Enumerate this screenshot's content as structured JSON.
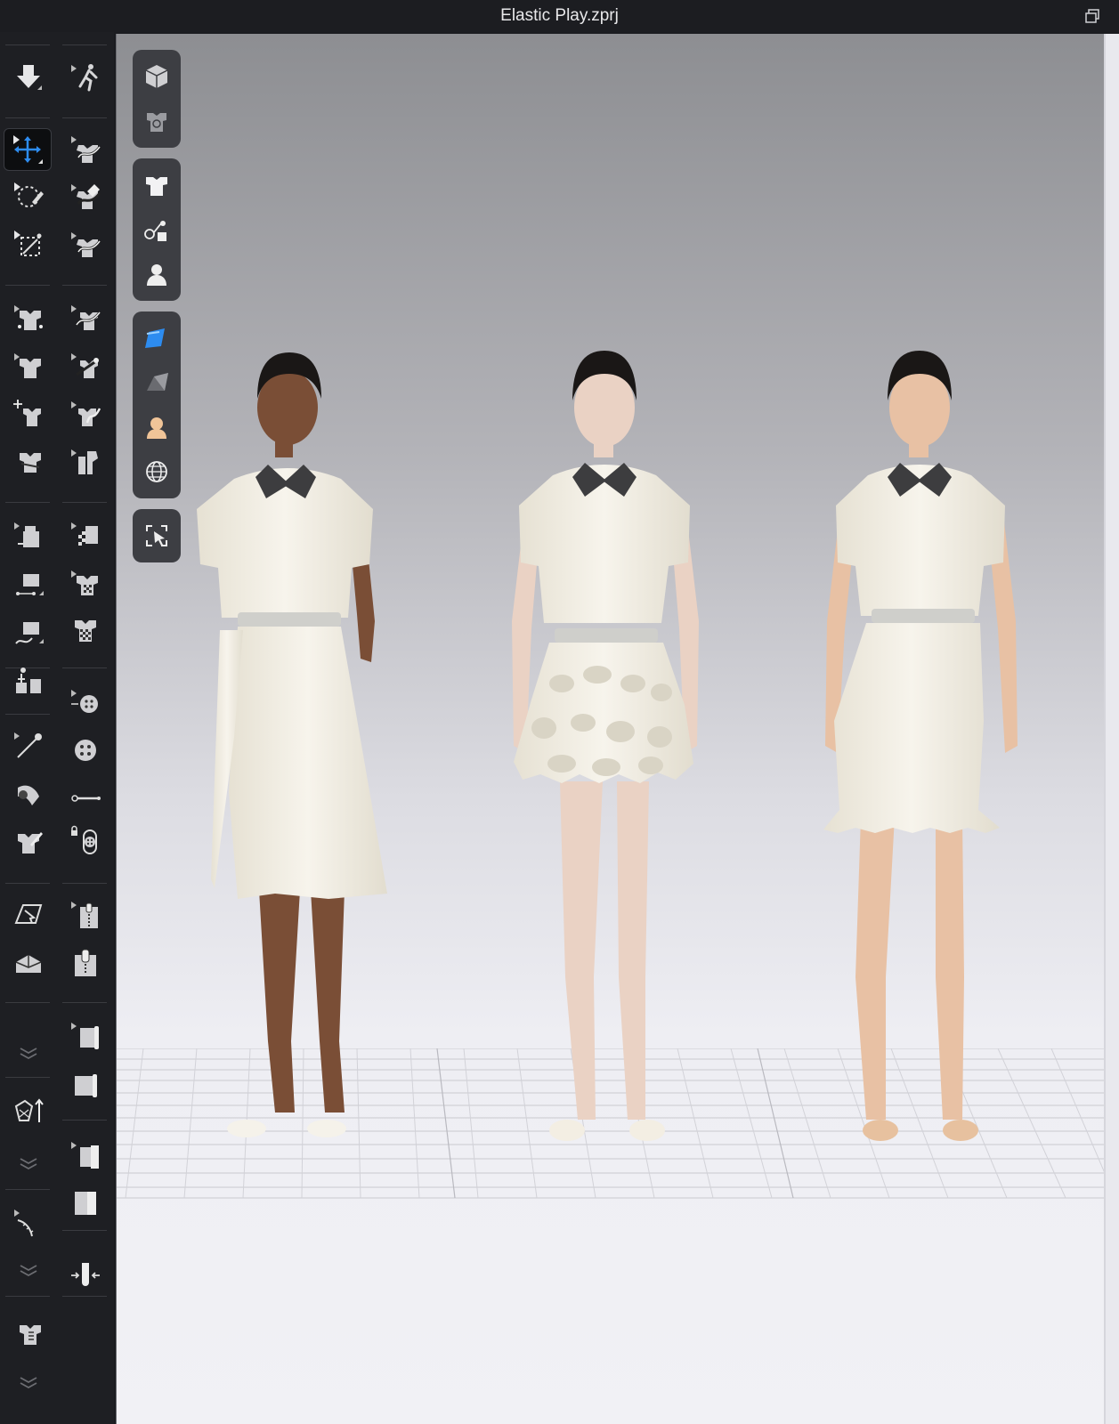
{
  "window": {
    "title": "Elastic Play.zprj"
  },
  "icons": {
    "restore": "restore-window-icon",
    "accent": "#2d8cf0"
  },
  "toolbar": {
    "left_column": [
      "avatar-move-down-icon",
      "transform-pattern-icon",
      "lasso-select-icon",
      "box-select-icon",
      "garment-point-icon",
      "garment-edit-icon",
      "garment-transform-icon",
      "garment-fold-icon",
      "sewing-segment-icon",
      "sewing-free-icon",
      "sewing-curve-icon",
      "tack-icon",
      "pin-icon",
      "stitch-roll-icon",
      "edit-texture-icon",
      "export-icon",
      "fold-arrange-icon",
      "chevron-down-icon",
      "measure-up-icon",
      "chevron-down-icon",
      "tape-measure-icon",
      "chevron-down-icon",
      "fit-map-icon",
      "chevron-down-icon"
    ],
    "right_column": [
      "avatar-pose-icon",
      "edit-curve-icon",
      "edit-curve-point-icon",
      "edit-curve-add-icon",
      "curve-move-icon",
      "curve-point-icon",
      "curve-edit-icon",
      "pattern-piece-icon",
      "texture-transform-icon",
      "fabric-pattern-icon",
      "checker-garment-icon",
      "button-add-icon",
      "button-icon",
      "buttonhole-icon",
      "lock-button-icon",
      "zipper-icon",
      "zipper-pull-icon",
      "puckering-icon",
      "fold-box-icon",
      "strap-icon",
      "rectangle-tool-icon",
      "shrink-icon"
    ]
  },
  "viewport_toolbar": {
    "groups": [
      [
        "view-3d-cube-icon",
        "garment-view-icon"
      ],
      [
        "shirt-icon",
        "trim-icon",
        "avatar-icon"
      ],
      [
        "fabric-render-icon",
        "shade-icon",
        "skin-icon",
        "globe-icon"
      ],
      [
        "select-screen-icon"
      ]
    ]
  },
  "scene": {
    "avatars": [
      {
        "skin": "#7a4e36",
        "skirt": "asymmetric-draped"
      },
      {
        "skin": "#ead2c4",
        "skirt": "ruffled"
      },
      {
        "skin": "#e8c1a4",
        "skirt": "fitted-ruffle-hem"
      }
    ],
    "colors": {
      "garment": "#f3efe4",
      "collar": "#3d3d3f",
      "belt": "#cfcfcb",
      "hair": "#1a1716"
    }
  }
}
